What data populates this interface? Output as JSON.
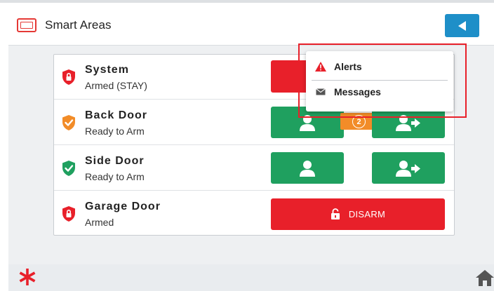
{
  "header": {
    "title": "Smart Areas",
    "panel_icon": "touchscreen-panel-icon",
    "back_icon": "back-arrow-icon"
  },
  "areas": [
    {
      "name": "System",
      "status": "Armed (STAY)",
      "shield_color": "#e8202a",
      "shield_icon": "lock-shield-icon"
    },
    {
      "name": "Back Door",
      "status": "Ready to Arm",
      "shield_color": "#f28c28",
      "shield_icon": "check-shield-icon"
    },
    {
      "name": "Side Door",
      "status": "Ready to Arm",
      "shield_color": "#1fa05f",
      "shield_icon": "check-shield-icon"
    },
    {
      "name": "Garage Door",
      "status": "Armed",
      "shield_color": "#e8202a",
      "shield_icon": "lock-shield-icon"
    }
  ],
  "buttons": {
    "disarm_label": "DISARM",
    "back_door_badge": "2"
  },
  "popup": {
    "items": [
      {
        "label": "Alerts",
        "icon": "warning-triangle-icon"
      },
      {
        "label": "Messages",
        "icon": "envelope-icon"
      }
    ]
  },
  "footer": {
    "left_icon": "asterisk-icon",
    "right_icon": "home-icon"
  },
  "colors": {
    "accent_blue": "#1e8fc8",
    "armed_red": "#e8202a",
    "ready_green": "#1fa05f",
    "warning_orange": "#f28c28"
  }
}
